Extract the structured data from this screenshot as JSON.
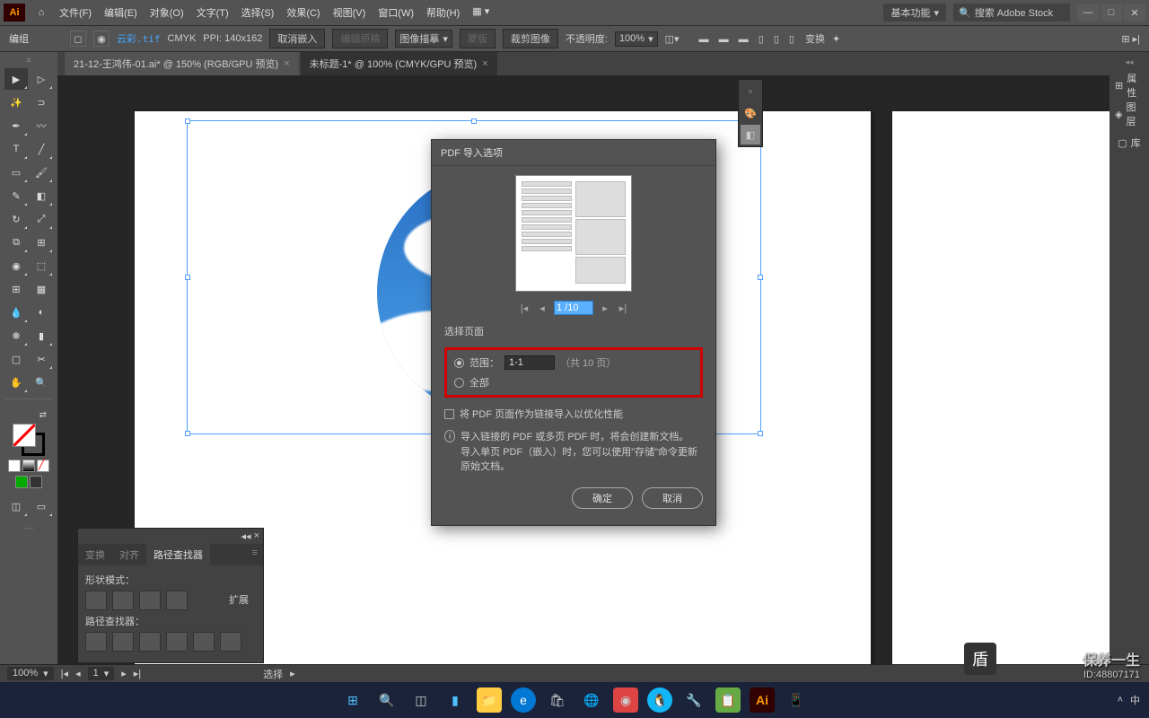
{
  "menu": {
    "file": "文件(F)",
    "edit": "编辑(E)",
    "object": "对象(O)",
    "text": "文字(T)",
    "select": "选择(S)",
    "effect": "效果(C)",
    "view": "视图(V)",
    "window": "窗口(W)",
    "help": "帮助(H)"
  },
  "workspace": "基本功能",
  "search_ph": "搜索 Adobe Stock",
  "options": {
    "group": "编组",
    "file": "云彩.tif",
    "colormode": "CMYK",
    "ppi": "PPI: 140x162",
    "unembed": "取消嵌入",
    "orig": "编辑原稿",
    "imgtrace": "图像描摹",
    "mask": "蒙版",
    "crop": "裁剪图像",
    "opacity_lbl": "不透明度:",
    "opacity_val": "100%",
    "transform": "变换"
  },
  "tabs": {
    "t1": "21-12-王鸿伟-01.ai* @ 150% (RGB/GPU 预览)",
    "t2": "未标题-1* @ 100% (CMYK/GPU 预览)"
  },
  "rightPanels": {
    "p1": "属性",
    "p2": "图层",
    "p3": "库"
  },
  "dialog": {
    "title": "PDF 导入选项",
    "page_input": "1 /10",
    "section": "选择页面",
    "range_lbl": "范围：",
    "range_val": "1-1",
    "range_suffix": "（共 10 页）",
    "all_lbl": "全部",
    "link_chk": "将 PDF 页面作为链接导入以优化性能",
    "info1": "导入链接的 PDF 或多页 PDF 时，将会创建新文档。",
    "info2": "导入单页 PDF（嵌入）时，您可以使用\"存储\"命令更新原始文档。",
    "ok": "确定",
    "cancel": "取消"
  },
  "pathfinder": {
    "tab1": "变换",
    "tab2": "对齐",
    "tab3": "路径查找器",
    "shape": "形状模式：",
    "expand": "扩展",
    "pf": "路径查找器："
  },
  "status": {
    "zoom": "100%",
    "page": "1",
    "sel": "选择"
  },
  "watermark": {
    "brand": "保养一生",
    "id": "ID:48807171"
  }
}
